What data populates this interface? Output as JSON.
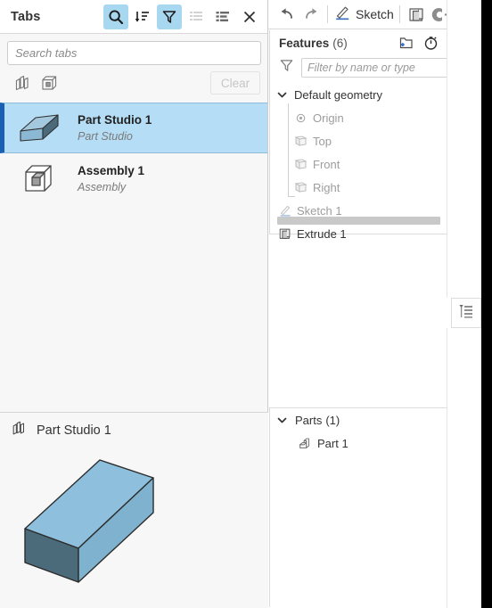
{
  "tabs_panel": {
    "title": "Tabs",
    "toolbar": [
      {
        "name": "search-icon",
        "active": true
      },
      {
        "name": "sort-icon",
        "active": false
      },
      {
        "name": "filter-icon",
        "active": true
      },
      {
        "name": "list-view-icon",
        "active": false
      },
      {
        "name": "detail-view-icon",
        "active": false
      },
      {
        "name": "close-icon",
        "active": false
      }
    ],
    "search": {
      "value": "",
      "placeholder": "Search tabs"
    },
    "filter_icons": [
      "part-studio-filter-icon",
      "assembly-filter-icon"
    ],
    "clear_label": "Clear",
    "items": [
      {
        "name": "Part Studio 1",
        "type": "Part Studio",
        "selected": true,
        "icon": "part-studio-thumbnail-icon"
      },
      {
        "name": "Assembly 1",
        "type": "Assembly",
        "selected": false,
        "icon": "assembly-thumbnail-icon"
      }
    ]
  },
  "preview": {
    "title": "Part Studio 1",
    "icon": "part-studio-icon",
    "model_colors": {
      "top": "#8ec0dd",
      "front": "#7fb2cf",
      "side": "#4c6b7a",
      "outline": "#2c2c2c"
    }
  },
  "top_toolbar": {
    "undo": "undo-icon",
    "redo": "redo-icon",
    "sketch_label": "Sketch",
    "sketch_icon": "sketch-pencil-icon",
    "extrude_icon": "extrude-icon",
    "revolve_icon": "revolve-icon"
  },
  "features": {
    "title": "Features",
    "count": "(6)",
    "header_buttons": [
      "new-folder-icon",
      "rollback-timer-icon"
    ],
    "filter": {
      "value": "",
      "placeholder": "Filter by name or type",
      "icon": "filter-icon"
    },
    "tree": [
      {
        "label": "Default geometry",
        "type": "group",
        "expanded": true,
        "icon": "chevron-down-icon",
        "dim": false
      },
      {
        "label": "Origin",
        "type": "child",
        "icon": "origin-icon",
        "dim": true
      },
      {
        "label": "Top",
        "type": "child",
        "icon": "plane-icon",
        "dim": true
      },
      {
        "label": "Front",
        "type": "child",
        "icon": "plane-icon",
        "dim": true
      },
      {
        "label": "Right",
        "type": "child",
        "icon": "plane-icon",
        "dim": true
      },
      {
        "label": "Sketch 1",
        "type": "feature",
        "icon": "sketch-pencil-icon",
        "dim": true
      },
      {
        "label": "Extrude 1",
        "type": "feature",
        "icon": "extrude-icon",
        "dim": false
      }
    ]
  },
  "parts": {
    "title": "Parts",
    "count": "(1)",
    "caret": "chevron-down-icon",
    "items": [
      {
        "label": "Part 1",
        "icon": "part-icon"
      }
    ]
  },
  "side_tool": {
    "icon": "feature-list-icon"
  },
  "colors": {
    "accent_blue": "#1a5fb4",
    "selected_row": "#b5ddf5",
    "toolbar_active": "#a8d7f0",
    "panel_bg": "#f7f7f7"
  }
}
